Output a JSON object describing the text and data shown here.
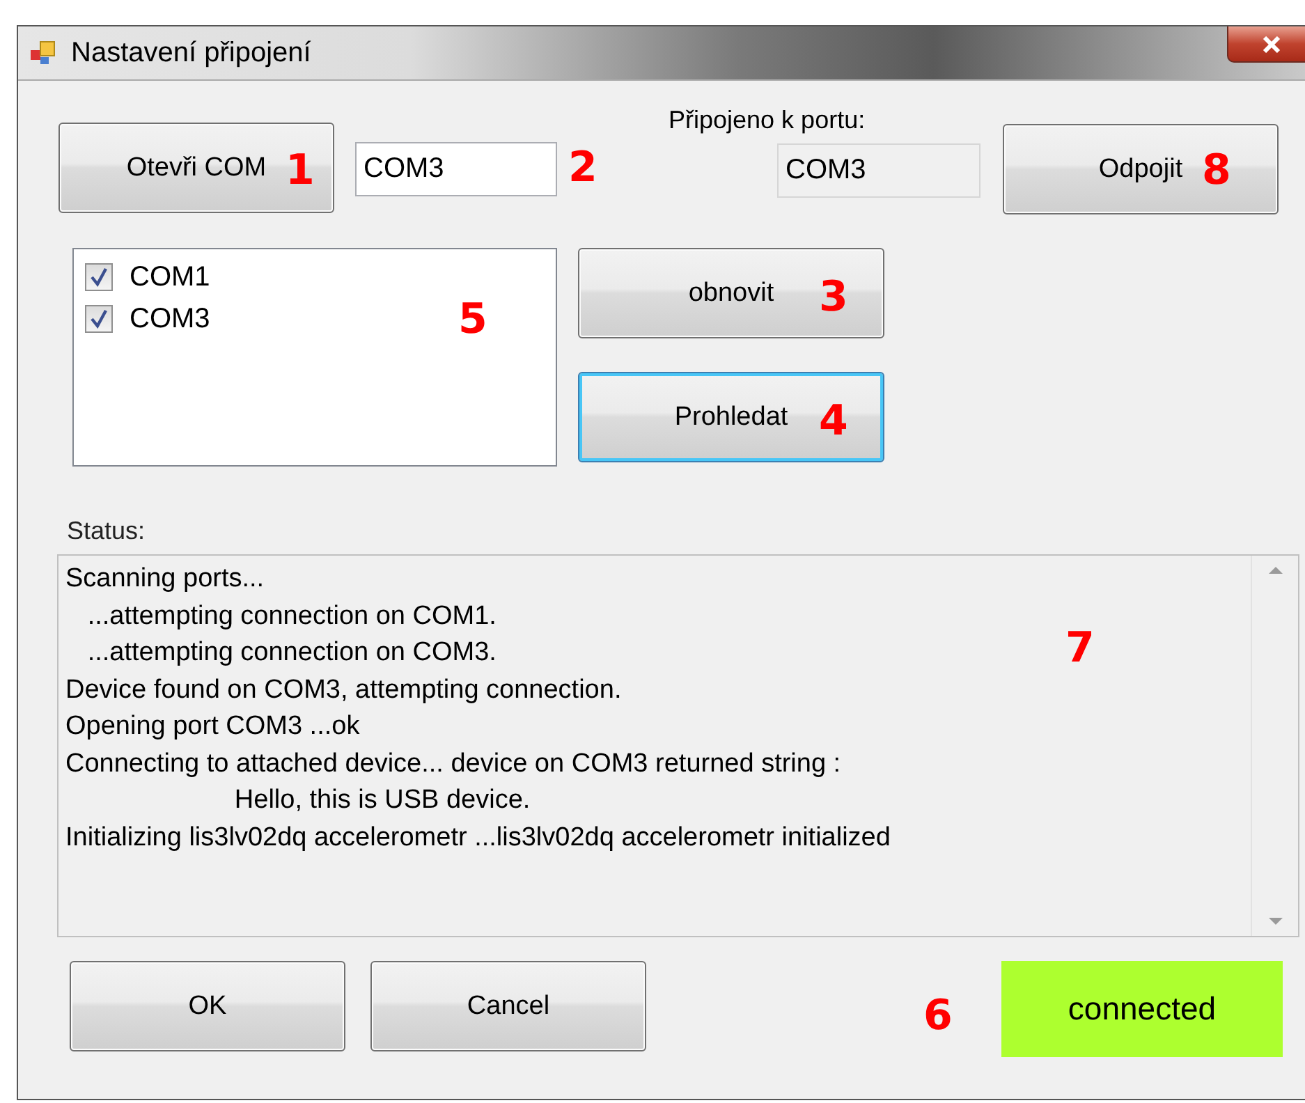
{
  "window": {
    "title": "Nastavení připojení"
  },
  "open_button": {
    "label": "Otevři COM",
    "callout": "1"
  },
  "port_field": {
    "value": "COM3",
    "callout": "2"
  },
  "connected_port": {
    "label": "Připojeno k portu:",
    "value": "COM3"
  },
  "disconnect_button": {
    "label": "Odpojit",
    "callout": "8"
  },
  "port_list": {
    "callout": "5",
    "items": [
      {
        "label": "COM1",
        "checked": true
      },
      {
        "label": "COM3",
        "checked": true
      }
    ]
  },
  "refresh_button": {
    "label": "obnovit",
    "focused": false,
    "callout": "3"
  },
  "scan_button": {
    "label": "Prohledat",
    "focused": true,
    "callout": "4"
  },
  "status": {
    "label": "Status:",
    "callout": "7",
    "lines": [
      "Scanning ports...",
      "   ...attempting connection on COM1.",
      "   ...attempting connection on COM3.",
      "Device found on COM3, attempting connection.",
      "Opening port COM3 ...ok",
      "Connecting to attached device... device on COM3 returned string :",
      "                       Hello, this is USB device.",
      "Initializing lis3lv02dq accelerometr ...lis3lv02dq accelerometr initialized"
    ]
  },
  "buttons": [
    {
      "label": "OK"
    },
    {
      "label": "Cancel"
    }
  ],
  "connection_state": {
    "label": "connected",
    "color": "#adff2f",
    "callout": "6"
  }
}
